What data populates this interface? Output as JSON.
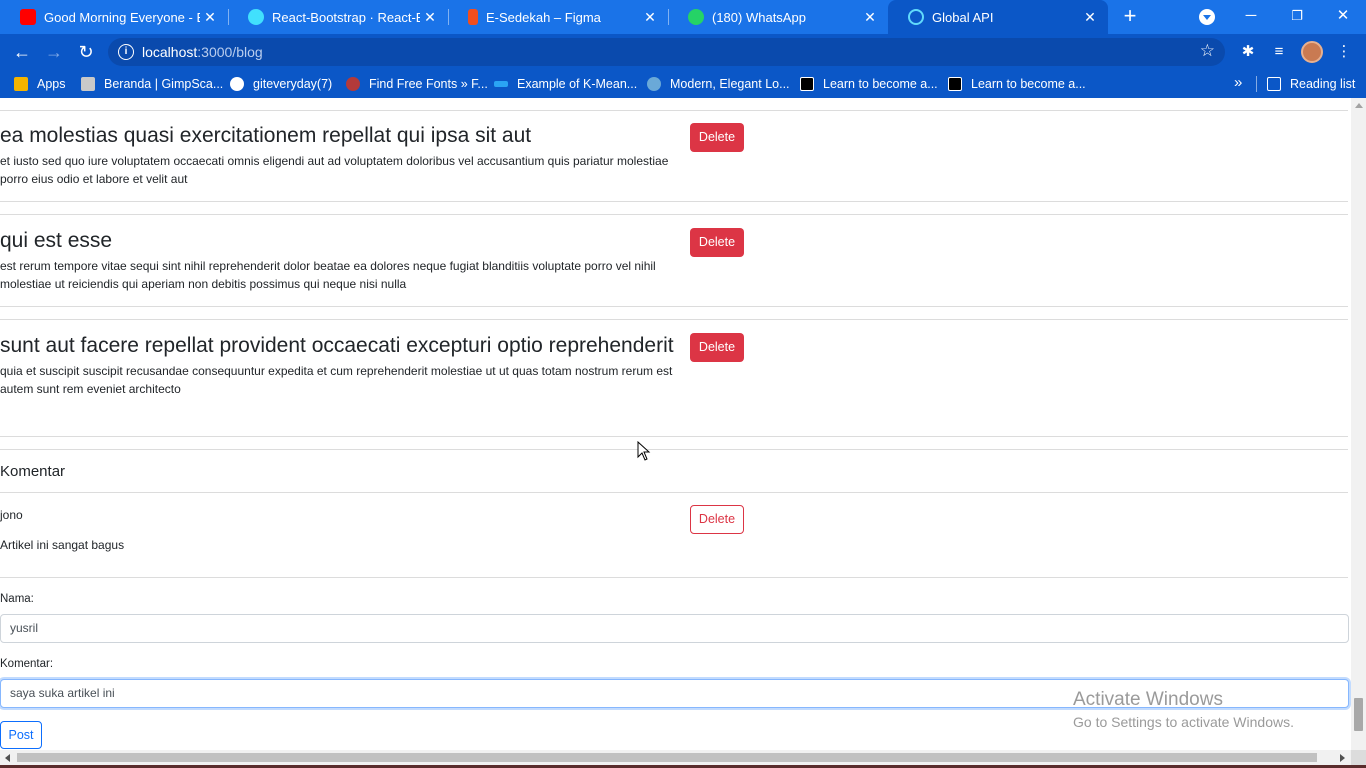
{
  "browser": {
    "tabs": [
      {
        "title": "Good Morning Everyone - Bu",
        "icon": "youtube-icon",
        "color": "#ff0000"
      },
      {
        "title": "React-Bootstrap · React-Boot",
        "icon": "react-bootstrap-icon",
        "color": "#41e0fd"
      },
      {
        "title": "E-Sedekah – Figma",
        "icon": "figma-icon",
        "color": "#f24e1e"
      },
      {
        "title": "(180) WhatsApp",
        "icon": "whatsapp-icon",
        "color": "#25d366"
      },
      {
        "title": "Global API",
        "icon": "react-icon",
        "color": "#61dafb"
      }
    ],
    "window_controls": {
      "minimize": "─",
      "restore": "❐",
      "close": "✕"
    },
    "url_host": "localhost",
    "url_path": ":3000/blog",
    "bookmarks": [
      {
        "label": "Apps",
        "icon": "apps-grid-icon",
        "color": "#f4b400"
      },
      {
        "label": "Beranda | GimpSca...",
        "icon": "gimp-icon",
        "color": "#c9c9c9"
      },
      {
        "label": "giteveryday(7)",
        "icon": "globe-icon",
        "color": "#ffffff"
      },
      {
        "label": "Find Free Fonts » F...",
        "icon": "font-icon",
        "color": "#b33a3a"
      },
      {
        "label": "Example of K-Mean...",
        "icon": "fish-icon",
        "color": "#2aa4f4"
      },
      {
        "label": "Modern, Elegant Lo...",
        "icon": "badge-icon",
        "color": "#6aa9d8"
      },
      {
        "label": "Learn to become a...",
        "icon": "r-icon",
        "color": "#000000"
      },
      {
        "label": "Learn to become a...",
        "icon": "r-icon",
        "color": "#000000"
      }
    ],
    "more_bookmarks": "»",
    "reading_list": "Reading list"
  },
  "posts": [
    {
      "title": "ea molestias quasi exercitationem repellat qui ipsa sit aut",
      "body": "et iusto sed quo iure voluptatem occaecati omnis eligendi aut ad voluptatem doloribus vel accusantium quis pariatur molestiae porro eius odio et labore et velit aut",
      "delete_label": "Delete"
    },
    {
      "title": "qui est esse",
      "body": "est rerum tempore vitae sequi sint nihil reprehenderit dolor beatae ea dolores neque fugiat blanditiis voluptate porro vel nihil molestiae ut reiciendis qui aperiam non debitis possimus qui neque nisi nulla",
      "delete_label": "Delete"
    },
    {
      "title": "sunt aut facere repellat provident occaecati excepturi optio reprehenderit",
      "body": "quia et suscipit suscipit recusandae consequuntur expedita et cum reprehenderit molestiae ut ut quas totam nostrum rerum est autem sunt rem eveniet architecto",
      "delete_label": "Delete"
    }
  ],
  "comments_section": {
    "title": "Komentar",
    "comments": [
      {
        "name": "jono",
        "text": "Artikel ini sangat bagus",
        "delete_label": "Delete"
      }
    ]
  },
  "form": {
    "name_label": "Nama:",
    "name_value": "yusril",
    "comment_label": "Komentar:",
    "comment_value": "saya suka artikel ini",
    "submit_label": "Post"
  },
  "watermark": {
    "line1": "Activate Windows",
    "line2": "Go to Settings to activate Windows."
  },
  "colors": {
    "chrome_blue": "#1a73e8",
    "danger": "#dc3545",
    "primary": "#0d6efd"
  }
}
